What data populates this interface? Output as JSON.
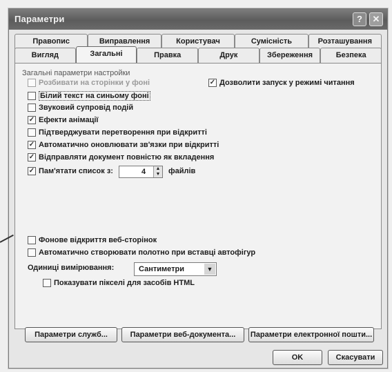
{
  "window": {
    "title": "Параметри",
    "help": "?",
    "close": "✕"
  },
  "tabs_back": [
    "Правопис",
    "Виправлення",
    "Користувач",
    "Сумісність",
    "Розташування"
  ],
  "tabs_front": [
    "Вигляд",
    "Загальні",
    "Правка",
    "Друк",
    "Збереження",
    "Безпека"
  ],
  "active_tab": "Загальні",
  "panel": {
    "group_label": "Загальні параметри настройки",
    "hidden_option": "Розбивати на сторінки у фоні",
    "background_save": "Білий текст на синьому фоні",
    "sound": "Звуковий супровід подій",
    "animation": "Ефекти анімації",
    "confirm_conversion": "Підтверджувати перетворення при відкритті",
    "auto_update_links": "Автоматично оновлювати зв'язки при відкритті",
    "mail_attachment": "Відправляти документ повністю як вкладення",
    "recent_files_label": "Пам'ятати список з:",
    "recent_files_count": "4",
    "recent_files_unit": "файлів",
    "reading_mode": "Дозволити запуск у режимі читання",
    "web_background": "Фонове відкриття веб-сторінок",
    "auto_canvas": "Автоматично створювати полотно при вставці автофігур",
    "units_label": "Одиниці вимірювання:",
    "units_value": "Сантиметри",
    "pixels_html": "Показувати пікселі для засобів HTML"
  },
  "buttons": {
    "service": "Параметри служб...",
    "web_options": "Параметри веб-документа...",
    "email_options": "Параметри електронної пошти...",
    "ok": "OK",
    "cancel": "Скасувати"
  }
}
